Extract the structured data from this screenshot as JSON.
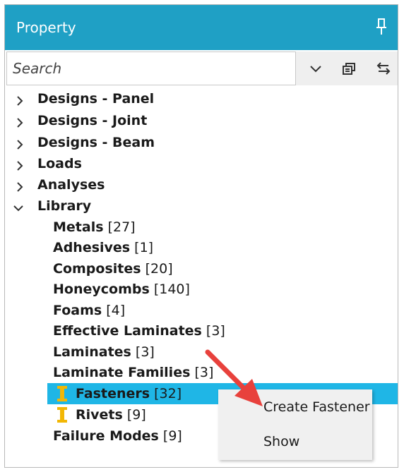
{
  "panel": {
    "title": "Property"
  },
  "search": {
    "placeholder": "Search"
  },
  "toolbar": {
    "icons": [
      "chevron-down-icon",
      "stack-icon",
      "swap-arrows-icon"
    ]
  },
  "tree": {
    "top_nodes": [
      {
        "label": "Designs - Panel"
      },
      {
        "label": "Designs - Joint"
      },
      {
        "label": "Designs - Beam"
      },
      {
        "label": "Loads"
      },
      {
        "label": "Analyses"
      },
      {
        "label": "Library"
      }
    ],
    "library": [
      {
        "label": "Metals",
        "count": "[27]"
      },
      {
        "label": "Adhesives",
        "count": "[1]"
      },
      {
        "label": "Composites",
        "count": "[20]"
      },
      {
        "label": "Honeycombs",
        "count": "[140]"
      },
      {
        "label": "Foams",
        "count": "[4]"
      },
      {
        "label": "Effective Laminates",
        "count": "[3]"
      },
      {
        "label": "Laminates",
        "count": "[3]"
      },
      {
        "label": "Laminate Families",
        "count": "[3]"
      },
      {
        "label": "Fasteners",
        "count": "[32]"
      },
      {
        "label": "Rivets",
        "count": "[9]"
      },
      {
        "label": "Failure Modes",
        "count": "[9]"
      }
    ]
  },
  "context_menu": {
    "items": [
      "Create Fastener",
      "Show"
    ]
  },
  "colors": {
    "header": "#1fa0c5",
    "selection": "#1fb6e6",
    "fastener_icon": "#f2b705",
    "arrow": "#e8413c"
  }
}
